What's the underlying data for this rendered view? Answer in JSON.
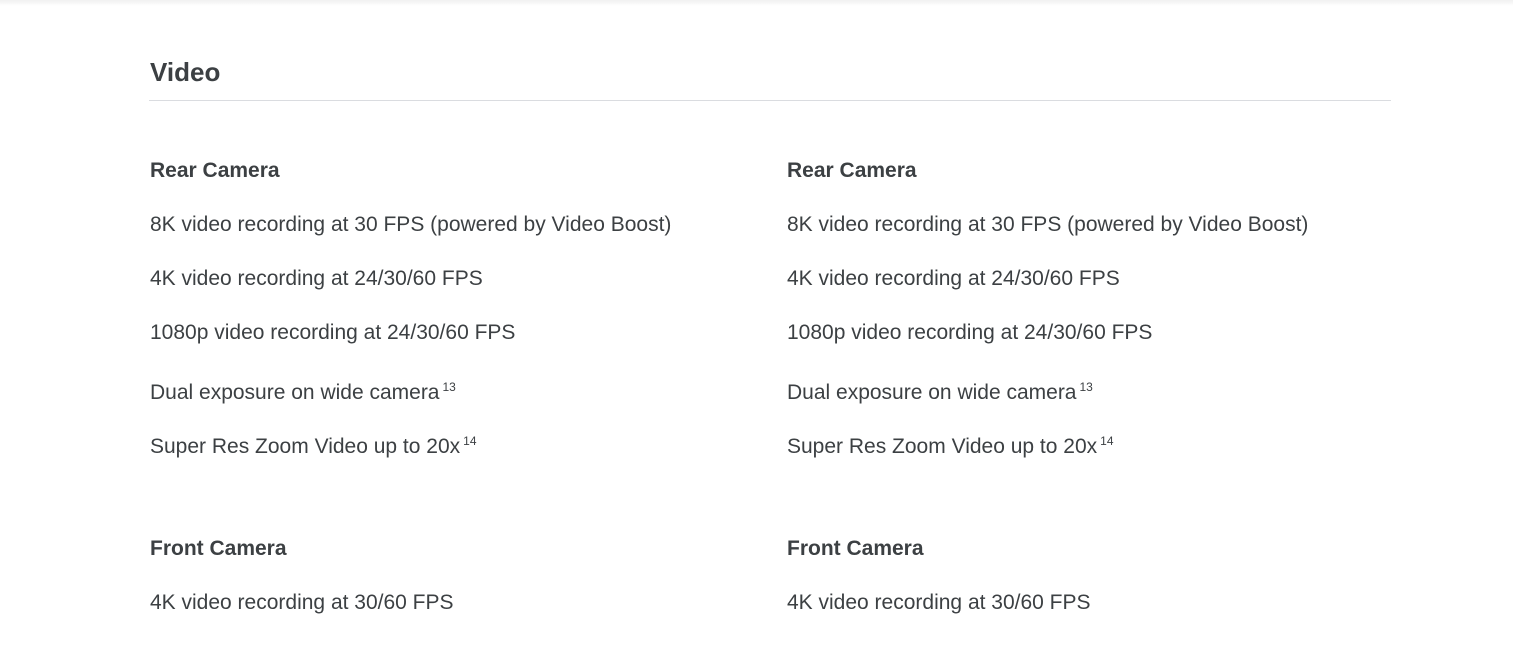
{
  "section": {
    "title": "Video"
  },
  "columns": [
    {
      "rear_camera": {
        "heading": "Rear Camera",
        "items": [
          {
            "text": "8K video recording at 30 FPS (powered by Video Boost)",
            "footnote": ""
          },
          {
            "text": "4K video recording at 24/30/60 FPS",
            "footnote": ""
          },
          {
            "text": "1080p video recording at 24/30/60 FPS",
            "footnote": ""
          },
          {
            "text": "Dual exposure on wide camera",
            "footnote": "13"
          },
          {
            "text": "Super Res Zoom Video up to 20x",
            "footnote": "14"
          }
        ]
      },
      "front_camera": {
        "heading": "Front Camera",
        "items": [
          {
            "text": "4K video recording at 30/60 FPS",
            "footnote": ""
          }
        ]
      }
    },
    {
      "rear_camera": {
        "heading": "Rear Camera",
        "items": [
          {
            "text": "8K video recording at 30 FPS (powered by Video Boost)",
            "footnote": ""
          },
          {
            "text": "4K video recording at 24/30/60 FPS",
            "footnote": ""
          },
          {
            "text": "1080p video recording at 24/30/60 FPS",
            "footnote": ""
          },
          {
            "text": "Dual exposure on wide camera",
            "footnote": "13"
          },
          {
            "text": "Super Res Zoom Video up to 20x",
            "footnote": "14"
          }
        ]
      },
      "front_camera": {
        "heading": "Front Camera",
        "items": [
          {
            "text": "4K video recording at 30/60 FPS",
            "footnote": ""
          }
        ]
      }
    }
  ]
}
